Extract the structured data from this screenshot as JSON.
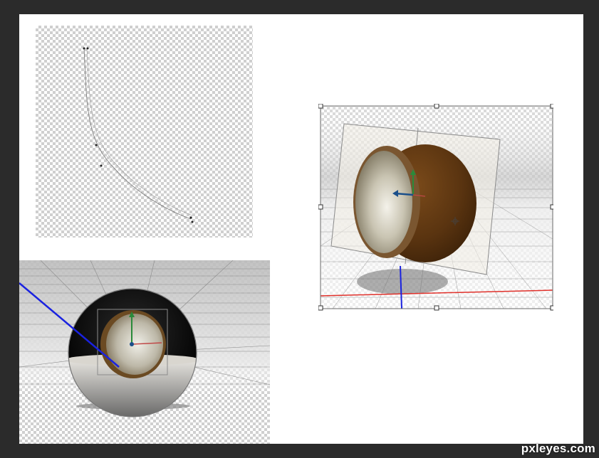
{
  "watermark": {
    "text": "pxleyes.com"
  },
  "colors": {
    "workspace": "#2b2b2b",
    "document": "#ffffff",
    "axis_x": "#e0302a",
    "axis_y": "#2a8a3a",
    "axis_z": "#1030d8",
    "sphere_brown": "#5a3410"
  },
  "panels": [
    {
      "id": "path-panel",
      "content": "curve-path-with-anchor-points"
    },
    {
      "id": "sphere-panel",
      "content": "3d-glass-sphere-with-compass"
    },
    {
      "id": "transform-panel",
      "content": "3d-half-sphere-with-plane-and-transform-box"
    }
  ]
}
